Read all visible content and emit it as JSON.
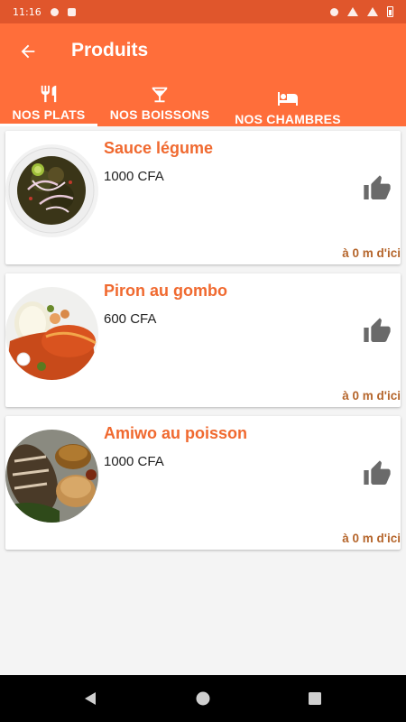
{
  "status_bar": {
    "time": "11:16"
  },
  "header": {
    "title": "Produits",
    "back_icon": "arrow-back-icon"
  },
  "tabs": [
    {
      "label": "NOS PLATS",
      "icon": "restaurant-icon",
      "selected": true
    },
    {
      "label": "NOS BOISSONS",
      "icon": "cocktail-icon",
      "selected": false
    },
    {
      "label": "NOS CHAMBRES",
      "icon": "hotel-bed-icon",
      "selected": false
    }
  ],
  "products": [
    {
      "name": "Sauce légume",
      "price": "1000 CFA",
      "distance": "à 0 m d'ici"
    },
    {
      "name": "Piron au gombo",
      "price": "600 CFA",
      "distance": "à 0 m d'ici"
    },
    {
      "name": "Amiwo au poisson",
      "price": "1000 CFA",
      "distance": "à 0 m d'ici"
    }
  ],
  "colors": {
    "app_bar": "#ff6e3a",
    "status_bar": "#e0562c",
    "product_name": "#f0692f",
    "distance": "#b5652b",
    "like_icon": "#6a6a6a",
    "background": "#f4f4f4"
  },
  "nav_bar": {
    "icons": [
      "back-triangle-icon",
      "home-circle-icon",
      "recents-square-icon"
    ]
  }
}
